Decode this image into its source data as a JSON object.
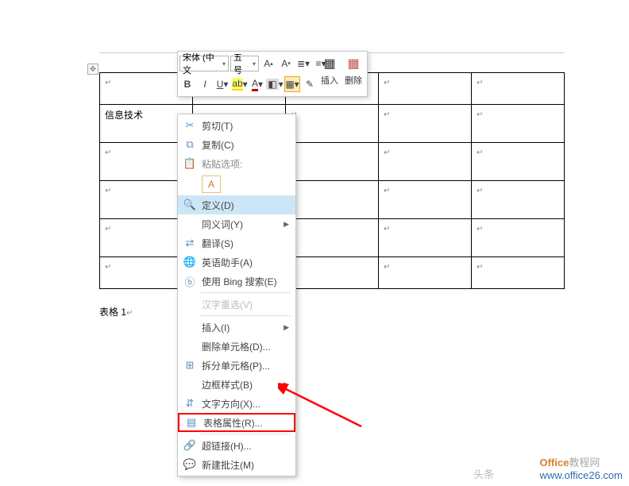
{
  "table": {
    "caption": "表格 1",
    "cell_text": "信息技术",
    "para_mark": "↵"
  },
  "toolbar": {
    "font_name": "宋体 (中文",
    "font_size": "五号",
    "bold": "B",
    "italic": "I",
    "insert_label": "插入",
    "delete_label": "删除"
  },
  "ctx": {
    "cut": "剪切(T)",
    "copy": "复制(C)",
    "paste_header": "粘贴选项:",
    "keep_text": "A",
    "define": "定义(D)",
    "synonym": "同义词(Y)",
    "translate": "翻译(S)",
    "english_helper": "英语助手(A)",
    "bing": "使用 Bing 搜索(E)",
    "hanzi": "汉字重选(V)",
    "insert": "插入(I)",
    "delete_cells": "删除单元格(D)...",
    "split_cells": "拆分单元格(P)...",
    "border_style": "边框样式(B)",
    "text_direction": "文字方向(X)...",
    "table_props": "表格属性(R)...",
    "hyperlink": "超链接(H)...",
    "new_comment": "新建批注(M)"
  },
  "watermark": {
    "toutiao": "头条",
    "brand1": "Office",
    "brand2": "教程网",
    "url": "www.office26.com"
  }
}
